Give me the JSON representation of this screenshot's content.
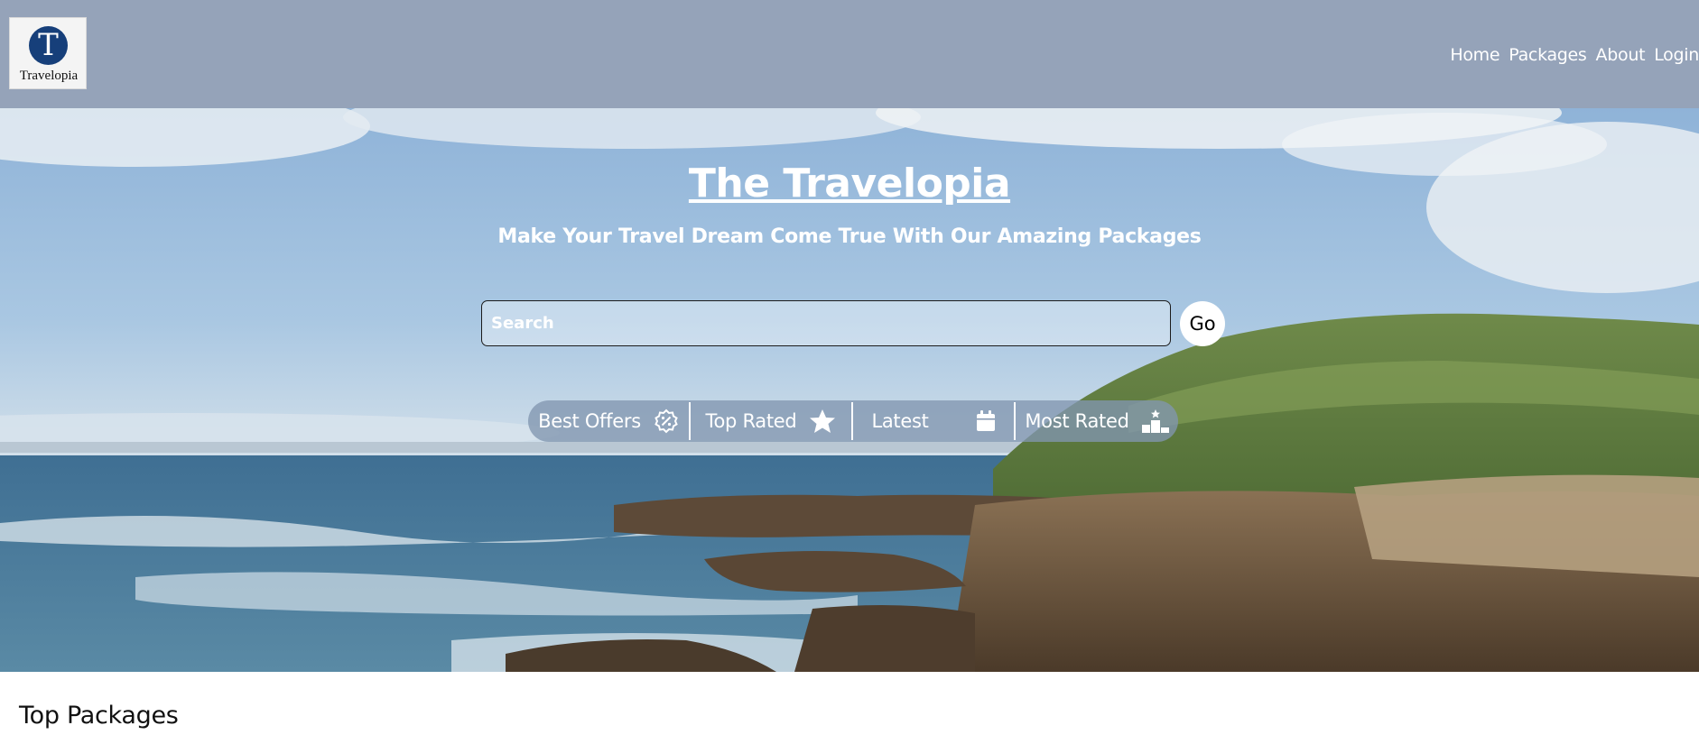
{
  "header": {
    "logo_text": "Travelopia",
    "logo_letter": "T",
    "nav": [
      "Home",
      "Packages",
      "About",
      "Login"
    ]
  },
  "hero": {
    "title": "The Travelopia",
    "subtitle": "Make Your Travel Dream Come True With Our Amazing Packages",
    "search": {
      "placeholder": "Search",
      "value": ""
    },
    "go_label": "Go",
    "filters": [
      {
        "label": "Best Offers",
        "icon": "discount-badge-icon"
      },
      {
        "label": "Top Rated",
        "icon": "star-icon"
      },
      {
        "label": "Latest",
        "icon": "calendar-icon"
      },
      {
        "label": "Most Rated",
        "icon": "podium-icon"
      }
    ]
  },
  "section": {
    "title": "Top Packages"
  },
  "colors": {
    "header_bg": "#95a3b9",
    "logo_mark": "#163f7a",
    "text_light": "#ffffff"
  }
}
